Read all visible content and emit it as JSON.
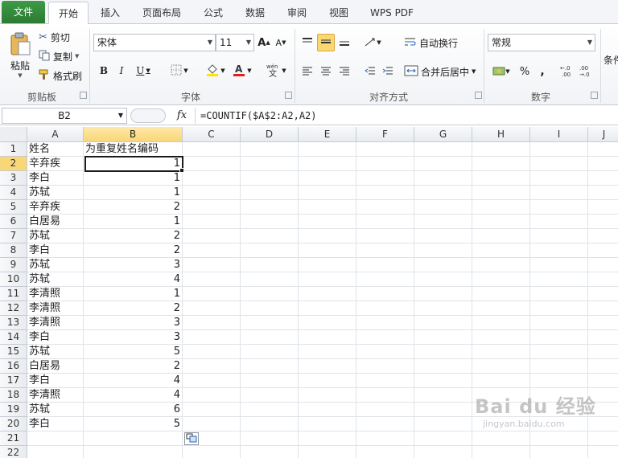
{
  "tabs": [
    "文件",
    "开始",
    "插入",
    "页面布局",
    "公式",
    "数据",
    "审阅",
    "视图",
    "WPS PDF"
  ],
  "clipboard": {
    "paste": "粘贴",
    "cut": "剪切",
    "copy": "复制",
    "format_painter": "格式刷",
    "label": "剪贴板"
  },
  "font": {
    "name": "宋体",
    "size": "11",
    "grow": "A",
    "shrink": "A",
    "bold": "B",
    "italic": "I",
    "underline": "U",
    "label": "字体"
  },
  "alignment": {
    "wrap": "自动换行",
    "merge": "合并后居中",
    "label": "对齐方式"
  },
  "number": {
    "format": "常规",
    "percent": "%",
    "comma": ",",
    "label": "数字"
  },
  "styles": {
    "label": "条件"
  },
  "formula_bar": {
    "cell_ref": "B2",
    "fx": "fx",
    "formula": "=COUNTIF($A$2:A2,A2)"
  },
  "columns": [
    "A",
    "B",
    "C",
    "D",
    "E",
    "F",
    "G",
    "H",
    "I",
    "J"
  ],
  "rows": [
    {
      "num": "1",
      "a": "姓名",
      "b": "为重复姓名编码"
    },
    {
      "num": "2",
      "a": "辛弃疾",
      "b": "1"
    },
    {
      "num": "3",
      "a": "李白",
      "b": "1"
    },
    {
      "num": "4",
      "a": "苏轼",
      "b": "1"
    },
    {
      "num": "5",
      "a": "辛弃疾",
      "b": "2"
    },
    {
      "num": "6",
      "a": "白居易",
      "b": "1"
    },
    {
      "num": "7",
      "a": "苏轼",
      "b": "2"
    },
    {
      "num": "8",
      "a": "李白",
      "b": "2"
    },
    {
      "num": "9",
      "a": "苏轼",
      "b": "3"
    },
    {
      "num": "10",
      "a": "苏轼",
      "b": "4"
    },
    {
      "num": "11",
      "a": "李清照",
      "b": "1"
    },
    {
      "num": "12",
      "a": "李清照",
      "b": "2"
    },
    {
      "num": "13",
      "a": "李清照",
      "b": "3"
    },
    {
      "num": "14",
      "a": "李白",
      "b": "3"
    },
    {
      "num": "15",
      "a": "苏轼",
      "b": "5"
    },
    {
      "num": "16",
      "a": "白居易",
      "b": "2"
    },
    {
      "num": "17",
      "a": "李白",
      "b": "4"
    },
    {
      "num": "18",
      "a": "李清照",
      "b": "4"
    },
    {
      "num": "19",
      "a": "苏轼",
      "b": "6"
    },
    {
      "num": "20",
      "a": "李白",
      "b": "5"
    },
    {
      "num": "21",
      "a": "",
      "b": ""
    },
    {
      "num": "22",
      "a": "",
      "b": ""
    }
  ],
  "watermark": {
    "main": "Bai du 经验",
    "sub": "jingyan.baidu.com"
  }
}
